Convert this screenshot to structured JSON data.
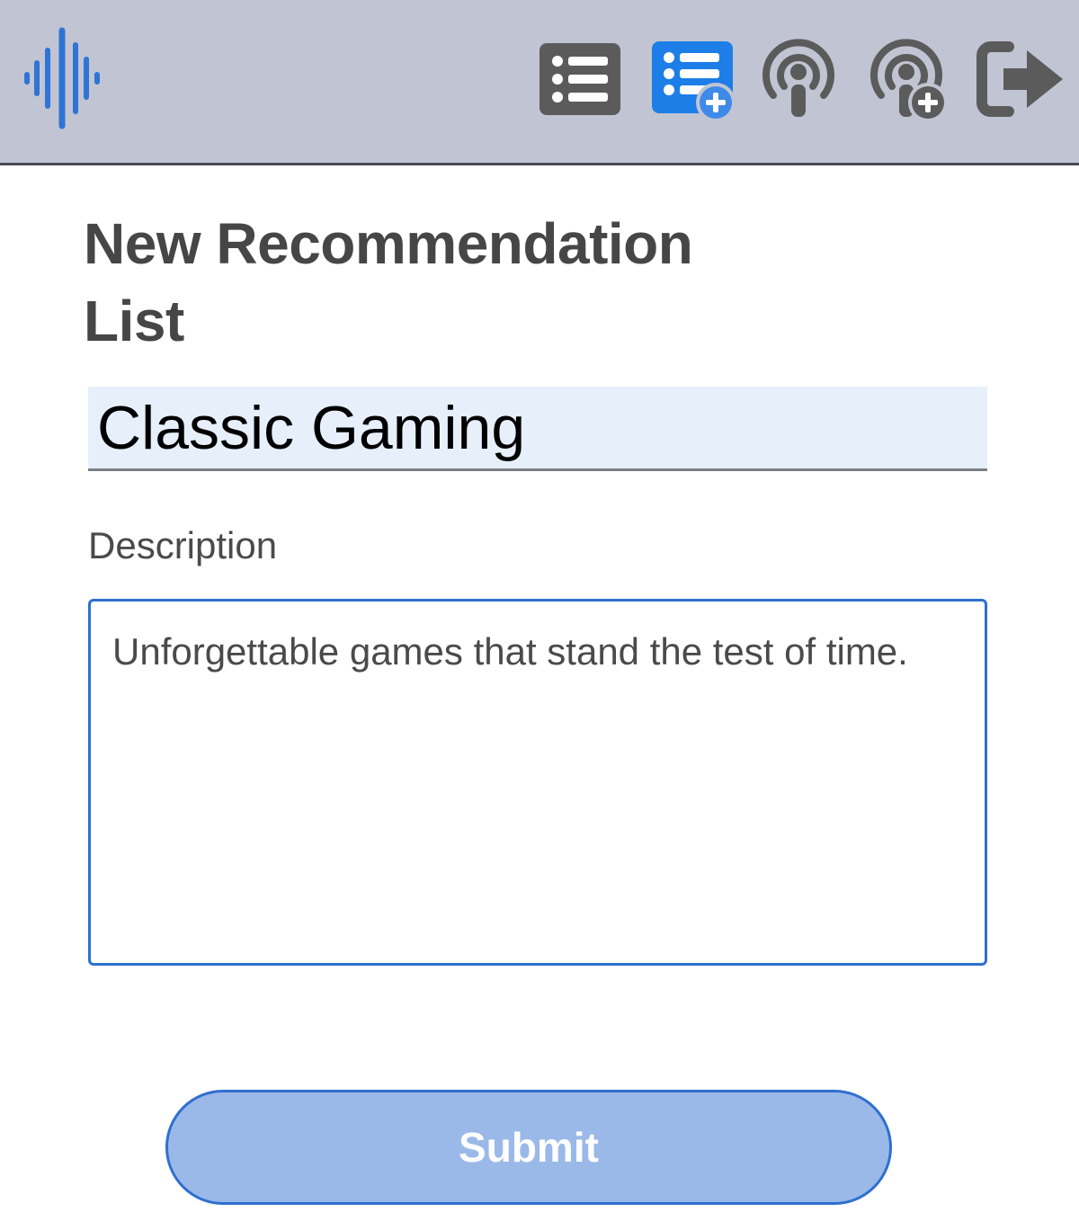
{
  "header": {
    "logo_icon": "audio-waveform-icon",
    "nav": [
      {
        "icon": "list-icon",
        "label": "Recommendation lists",
        "color": "#5b5b5b"
      },
      {
        "icon": "list-add-icon",
        "label": "New recommendation list",
        "color": "#1c7ee6",
        "active": true
      },
      {
        "icon": "podcast-icon",
        "label": "Podcasts",
        "color": "#5b5b5b"
      },
      {
        "icon": "podcast-add-icon",
        "label": "Add podcast",
        "color": "#5b5b5b"
      },
      {
        "icon": "sign-out-icon",
        "label": "Sign out",
        "color": "#5b5b5b"
      }
    ]
  },
  "main": {
    "title": "New Recommendation List",
    "name_value": "Classic Gaming",
    "description_label": "Description",
    "description_value": "Unforgettable games that stand the test of time.",
    "submit_label": "Submit"
  },
  "colors": {
    "accent": "#1c7ee6",
    "header_bg": "#c1c4d2",
    "input_bg": "#e7effb",
    "button_bg": "#9ab9e9",
    "button_border": "#2f6fcf"
  }
}
